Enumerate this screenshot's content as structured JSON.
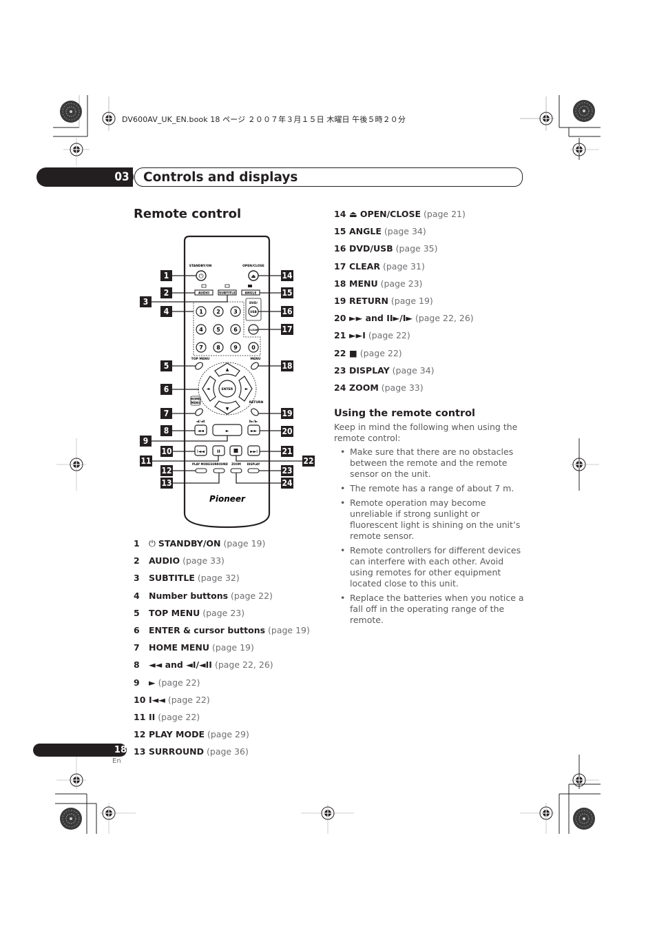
{
  "print_header": "DV600AV_UK_EN.book  18 ページ  ２００７年３月１５日  木曜日  午後５時２０分",
  "chapter": {
    "number": "03",
    "title": "Controls and displays"
  },
  "section_title": "Remote control",
  "remote": {
    "brand": "Pioneer",
    "labels": {
      "standby": "STANDBY/ON",
      "open_close": "OPEN/CLOSE",
      "audio": "AUDIO",
      "subtitle": "SUBTITLE",
      "angle": "ANGLE",
      "dvd_usb_top": "DVD/",
      "dvd_usb_btn": "USB",
      "clear": "CLEAR",
      "top_menu": "TOP MENU",
      "menu": "MENU",
      "enter": "ENTER",
      "home_menu_1": "HOME",
      "home_menu_2": "MENU",
      "return": "RETURN",
      "play_mode": "PLAY MODE",
      "surround": "SURROUND",
      "zoom": "ZOOM",
      "display": "DISPLAY",
      "rev_slow": "◄I/◄II",
      "fwd_slow": "II►/I►"
    },
    "number_buttons": [
      "1",
      "2",
      "3",
      "4",
      "5",
      "6",
      "7",
      "8",
      "9",
      "0"
    ],
    "callouts": [
      "1",
      "2",
      "3",
      "4",
      "5",
      "6",
      "7",
      "8",
      "9",
      "10",
      "11",
      "12",
      "13",
      "14",
      "15",
      "16",
      "17",
      "18",
      "19",
      "20",
      "21",
      "22",
      "23",
      "24"
    ]
  },
  "items_left": [
    {
      "num": "1",
      "icon": "⏻",
      "label": "STANDBY/ON",
      "page": "(page 19)"
    },
    {
      "num": "2",
      "icon": "",
      "label": "AUDIO",
      "page": "(page 33)"
    },
    {
      "num": "3",
      "icon": "",
      "label": "SUBTITLE",
      "page": "(page 32)"
    },
    {
      "num": "4",
      "icon": "",
      "label": "Number buttons",
      "page": "(page 22)"
    },
    {
      "num": "5",
      "icon": "",
      "label": "TOP MENU",
      "page": "(page 23)"
    },
    {
      "num": "6",
      "icon": "",
      "label": "ENTER & cursor buttons",
      "page": "(page 19)"
    },
    {
      "num": "7",
      "icon": "",
      "label": "HOME MENU",
      "page": "(page 19)"
    },
    {
      "num": "8",
      "icon": "",
      "label": "◄◄ and ◄I/◄II",
      "page": "(page 22, 26)"
    },
    {
      "num": "9",
      "icon": "",
      "label": "►",
      "page": "(page 22)"
    },
    {
      "num": "10",
      "icon": "",
      "label": "I◄◄",
      "page": "(page 22)"
    },
    {
      "num": "11",
      "icon": "",
      "label": "II",
      "page": "(page 22)"
    },
    {
      "num": "12",
      "icon": "",
      "label": "PLAY MODE",
      "page": "(page 29)"
    },
    {
      "num": "13",
      "icon": "",
      "label": "SURROUND",
      "page": "(page 36)"
    }
  ],
  "items_right": [
    {
      "num": "14",
      "icon": "⏏",
      "label": "OPEN/CLOSE",
      "page": "(page 21)"
    },
    {
      "num": "15",
      "icon": "",
      "label": "ANGLE",
      "page": "(page 34)"
    },
    {
      "num": "16",
      "icon": "",
      "label": "DVD/USB",
      "page": "(page 35)"
    },
    {
      "num": "17",
      "icon": "",
      "label": "CLEAR",
      "page": "(page 31)"
    },
    {
      "num": "18",
      "icon": "",
      "label": "MENU",
      "page": "(page 23)"
    },
    {
      "num": "19",
      "icon": "",
      "label": "RETURN",
      "page": "(page 19)"
    },
    {
      "num": "20",
      "icon": "",
      "label": "►► and II►/I►",
      "page": "(page 22, 26)"
    },
    {
      "num": "21",
      "icon": "",
      "label": "►►I",
      "page": "(page 22)"
    },
    {
      "num": "22",
      "icon": "",
      "label": "■",
      "page": "(page 22)"
    },
    {
      "num": "23",
      "icon": "",
      "label": "DISPLAY",
      "page": "(page 34)"
    },
    {
      "num": "24",
      "icon": "",
      "label": "ZOOM",
      "page": "(page 33)"
    }
  ],
  "using": {
    "title": "Using the remote control",
    "intro": "Keep in mind the following when using the remote control:",
    "bullets": [
      "Make sure that there are no obstacles between the remote and the remote sensor on the unit.",
      "The remote has a range of about 7 m.",
      "Remote operation may become unreliable if strong sunlight or fluorescent light is shining on the unit’s remote sensor.",
      "Remote controllers for different devices can interfere with each other. Avoid using remotes for other equipment located close to this unit.",
      "Replace the batteries when you notice a fall off in the operating range of the remote."
    ]
  },
  "footer": {
    "page_number": "18",
    "language": "En"
  }
}
